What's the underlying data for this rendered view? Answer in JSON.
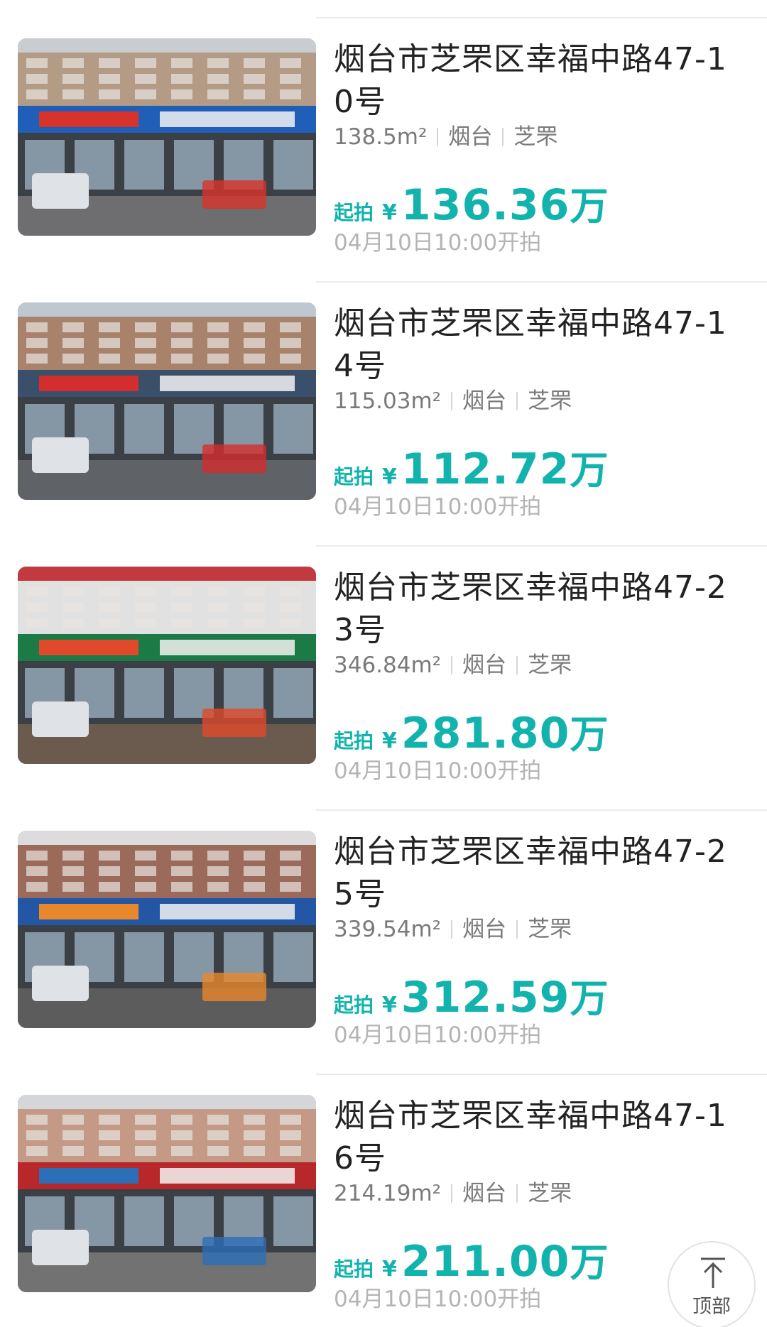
{
  "listings": [
    {
      "title": "烟台市芝罘区幸福中路47-10号",
      "area": "138.5m²",
      "city": "烟台",
      "district": "芝罘",
      "price_prefix": "起拍",
      "currency": "¥",
      "price": "136.36",
      "price_unit": "万",
      "start_time": "04月10日10:00开拍",
      "photo_colors": {
        "sky": "#c9cdd2",
        "building": "#b49b86",
        "sign": "#1f5fb8",
        "accent": "#d8332b",
        "ground": "#6e6e70"
      }
    },
    {
      "title": "烟台市芝罘区幸福中路47-14号",
      "area": "115.03m²",
      "city": "烟台",
      "district": "芝罘",
      "price_prefix": "起拍",
      "currency": "¥",
      "price": "112.72",
      "price_unit": "万",
      "start_time": "04月10日10:00开拍",
      "photo_colors": {
        "sky": "#bfc7d0",
        "building": "#a8826b",
        "sign": "#3a4f6a",
        "accent": "#d42d2d",
        "ground": "#5f6266"
      }
    },
    {
      "title": "烟台市芝罘区幸福中路47-23号",
      "area": "346.84m²",
      "city": "烟台",
      "district": "芝罘",
      "price_prefix": "起拍",
      "currency": "¥",
      "price": "281.80",
      "price_unit": "万",
      "start_time": "04月10日10:00开拍",
      "photo_colors": {
        "sky": "#c23a3f",
        "building": "#e1e1e1",
        "sign": "#1b7a45",
        "accent": "#e04a2a",
        "ground": "#6a5b4e"
      }
    },
    {
      "title": "烟台市芝罘区幸福中路47-25号",
      "area": "339.54m²",
      "city": "烟台",
      "district": "芝罘",
      "price_prefix": "起拍",
      "currency": "¥",
      "price": "312.59",
      "price_unit": "万",
      "start_time": "04月10日10:00开拍",
      "photo_colors": {
        "sky": "#dcdcdc",
        "building": "#9c6a5a",
        "sign": "#2456a6",
        "accent": "#e8882a",
        "ground": "#5c5c5c"
      }
    },
    {
      "title": "烟台市芝罘区幸福中路47-16号",
      "area": "214.19m²",
      "city": "烟台",
      "district": "芝罘",
      "price_prefix": "起拍",
      "currency": "¥",
      "price": "211.00",
      "price_unit": "万",
      "start_time": "04月10日10:00开拍",
      "photo_colors": {
        "sky": "#d4d6da",
        "building": "#c49a86",
        "sign": "#b8282a",
        "accent": "#2c6fb6",
        "ground": "#727272"
      }
    }
  ],
  "back_to_top": {
    "label": "顶部",
    "icon": "arrow-up-icon"
  },
  "colors": {
    "accent": "#12b3ad",
    "title": "#222222",
    "meta": "#7a7a7a",
    "muted": "#b4b4b4"
  }
}
